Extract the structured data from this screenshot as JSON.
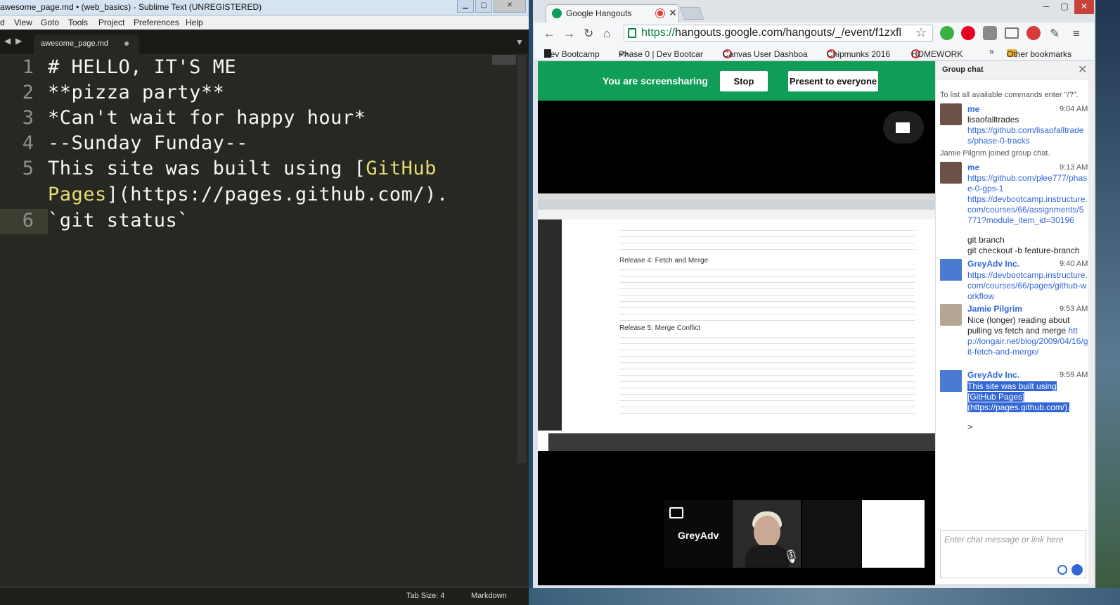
{
  "sublime": {
    "title": "awesome_page.md • (web_basics) - Sublime Text (UNREGISTERED)",
    "menu": [
      "d",
      "View",
      "Goto",
      "Tools",
      "Project",
      "Preferences",
      "Help"
    ],
    "tab_name": "awesome_page.md",
    "tab_dot": "●",
    "line_numbers": [
      "1",
      "2",
      "3",
      "4",
      "5",
      "",
      "6"
    ],
    "lines": {
      "l1": "# HELLO, IT'S ME",
      "l2": "**pizza party**",
      "l3": "*Can't wait for happy hour*",
      "l4": "--Sunday Funday--",
      "l5a": "This site was built using [",
      "l5b": "GitHub",
      "l5c": "Pages",
      "l5d": "](https://pages.github.com/).",
      "l6": "`git status`"
    },
    "status_tab_size": "Tab Size: 4",
    "status_syntax": "Markdown"
  },
  "chrome": {
    "tab_title": "Google Hangouts",
    "url_https": "https://",
    "url_rest": "hangouts.google.com/hangouts/_/event/f1zxfl",
    "bookmarks": [
      "Dev Bootcamp",
      "Phase 0 | Dev Bootcar",
      "Canvas User Dashboa",
      "Chipmunks 2016",
      "HOMEWORK",
      "»",
      "Other bookmarks"
    ]
  },
  "hangouts": {
    "screenshare_msg": "You are screensharing",
    "stop_label": "Stop",
    "present_label": "Present to everyone",
    "participant_label": "GreyAdv",
    "shared_doc": {
      "h1": "Release 4: Fetch and Merge",
      "h2": "Release 5: Merge Conflict"
    }
  },
  "chat": {
    "header": "Group chat",
    "commands_hint": "To list all available commands enter \"/?\".",
    "joined": "Jamie Pilgrim joined group chat.",
    "messages": [
      {
        "who": "me",
        "time": "9:04 AM",
        "l1": "lisaofalltrades",
        "link": "https://github.com/lisaofalltrades/phase-0-tracks"
      },
      {
        "who": "me",
        "time": "9:13 AM",
        "link": "https://github.com/plee777/phase-0-gps-1",
        "link2": "https://devbootcamp.instructure.com/courses/66/assignments/5771?module_item_id=30196",
        "l2": "git branch",
        "l3": "git checkout -b feature-branch"
      },
      {
        "who": "GreyAdv Inc.",
        "time": "9:40 AM",
        "link": "https://devbootcamp.instructure.com/courses/66/pages/github-workflow"
      },
      {
        "who": "Jamie Pilgrim",
        "time": "9:53 AM",
        "text": "Nice (longer) reading about pulling vs fetch and merge ",
        "link": "http://longair.net/blog/2009/04/16/git-fetch-and-merge/"
      },
      {
        "who": "GreyAdv Inc.",
        "time": "9:59 AM",
        "hl1": "This site was built using",
        "hl2": "[GitHub Pages]",
        "hl3": "(https://pages.github.com/)."
      }
    ],
    "caret": ">",
    "input_placeholder": "Enter chat message or link here"
  }
}
